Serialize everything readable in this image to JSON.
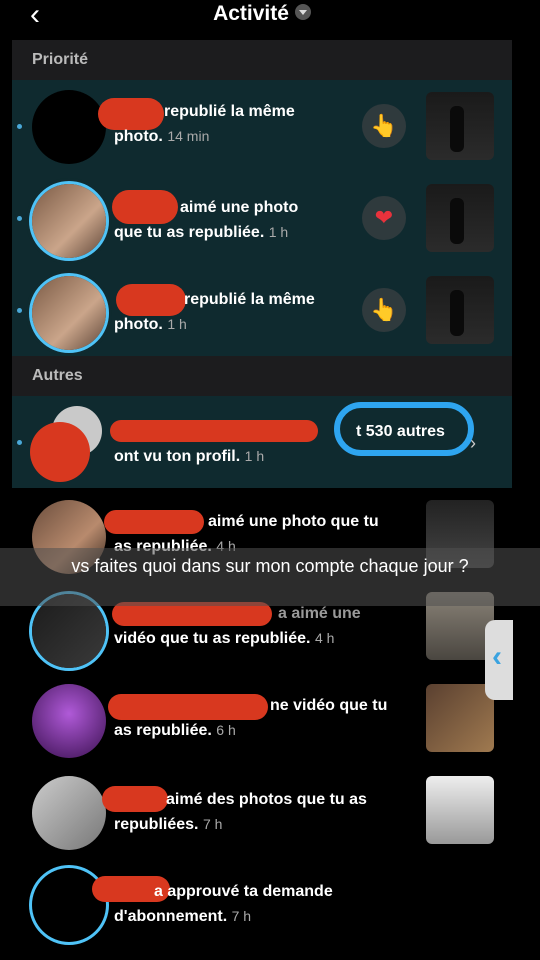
{
  "header": {
    "back_icon": "‹",
    "title": "Activité"
  },
  "sections": {
    "priority": "Priorité",
    "others": "Autres"
  },
  "priority_items": [
    {
      "text": "republié la même",
      "text2": "photo.",
      "time": "14 min",
      "reaction": "👆"
    },
    {
      "text": "aimé une photo",
      "text2": "que tu as republiée.",
      "time": "1 h",
      "reaction": "❤"
    },
    {
      "text": "republié la même",
      "text2": "photo.",
      "time": "1 h",
      "reaction": "👆"
    }
  ],
  "profile_views": {
    "count_text": "t 530 autres",
    "text2": "ont vu ton profil.",
    "time": "1 h"
  },
  "other_items": [
    {
      "text": "aimé une photo que tu",
      "text2": "as republiée.",
      "time": "4 h"
    },
    {
      "text": "a aimé une",
      "text2": "vidéo que tu as republiée.",
      "time": "4 h"
    },
    {
      "text": "ne vidéo que tu",
      "text2": "as republiée.",
      "time": "6 h"
    },
    {
      "text": "aimé des photos que tu as",
      "text2": "republiées.",
      "time": "7 h"
    },
    {
      "text": "a approuvé ta demande",
      "text2": "d'abonnement.",
      "time": "7 h"
    }
  ],
  "overlay_caption": "vs faites quoi dans sur mon compte chaque jour ?",
  "colors": {
    "accent": "#4fc3f7",
    "highlight_bg": "#0f2a2f",
    "redaction": "#d8381f",
    "annotation": "#2ea5f0"
  }
}
